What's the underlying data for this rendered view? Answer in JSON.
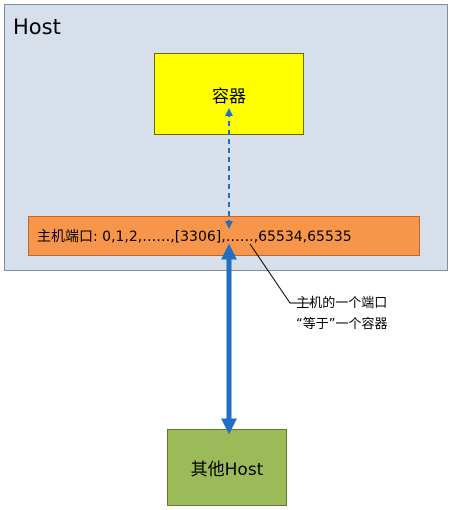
{
  "host": {
    "label": "Host"
  },
  "container": {
    "label": "容器"
  },
  "port_bar": {
    "label": "主机端口: 0,1,2,……,[3306],……,65534,65535"
  },
  "other_host": {
    "label": "其他Host"
  },
  "annotation": {
    "line1": "主机的一个端口",
    "line2": "“等于”一个容器"
  },
  "colors": {
    "host_fill": "#d7dfea",
    "container_fill": "#ffff00",
    "port_fill": "#f7954a",
    "other_host_fill": "#9bbb59",
    "arrow_blue": "#1f6fc4"
  }
}
